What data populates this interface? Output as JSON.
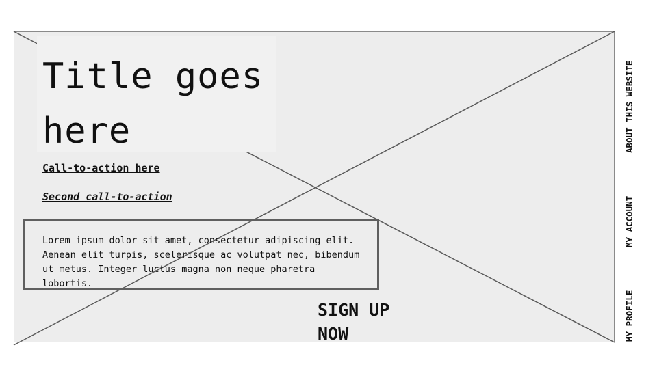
{
  "hero": {
    "title": "Title goes here",
    "cta_primary": "Call-to-action here",
    "cta_secondary": "Second call-to-action",
    "body": "Lorem ipsum dolor sit amet, consectetur adipiscing elit. Aenean elit turpis, scelerisque ac volutpat nec, bibendum ut metus. Integer luctus magna non neque pharetra lobortis.",
    "signup": "SIGN UP NOW"
  },
  "nav": {
    "items": [
      {
        "label": "ABOUT THIS WEBSITE"
      },
      {
        "label": "MY ACCOUNT"
      },
      {
        "label": "MY PROFILE"
      }
    ]
  },
  "colors": {
    "placeholder_bg": "#ededed",
    "placeholder_line": "#5a5a5a",
    "text": "#111111"
  }
}
